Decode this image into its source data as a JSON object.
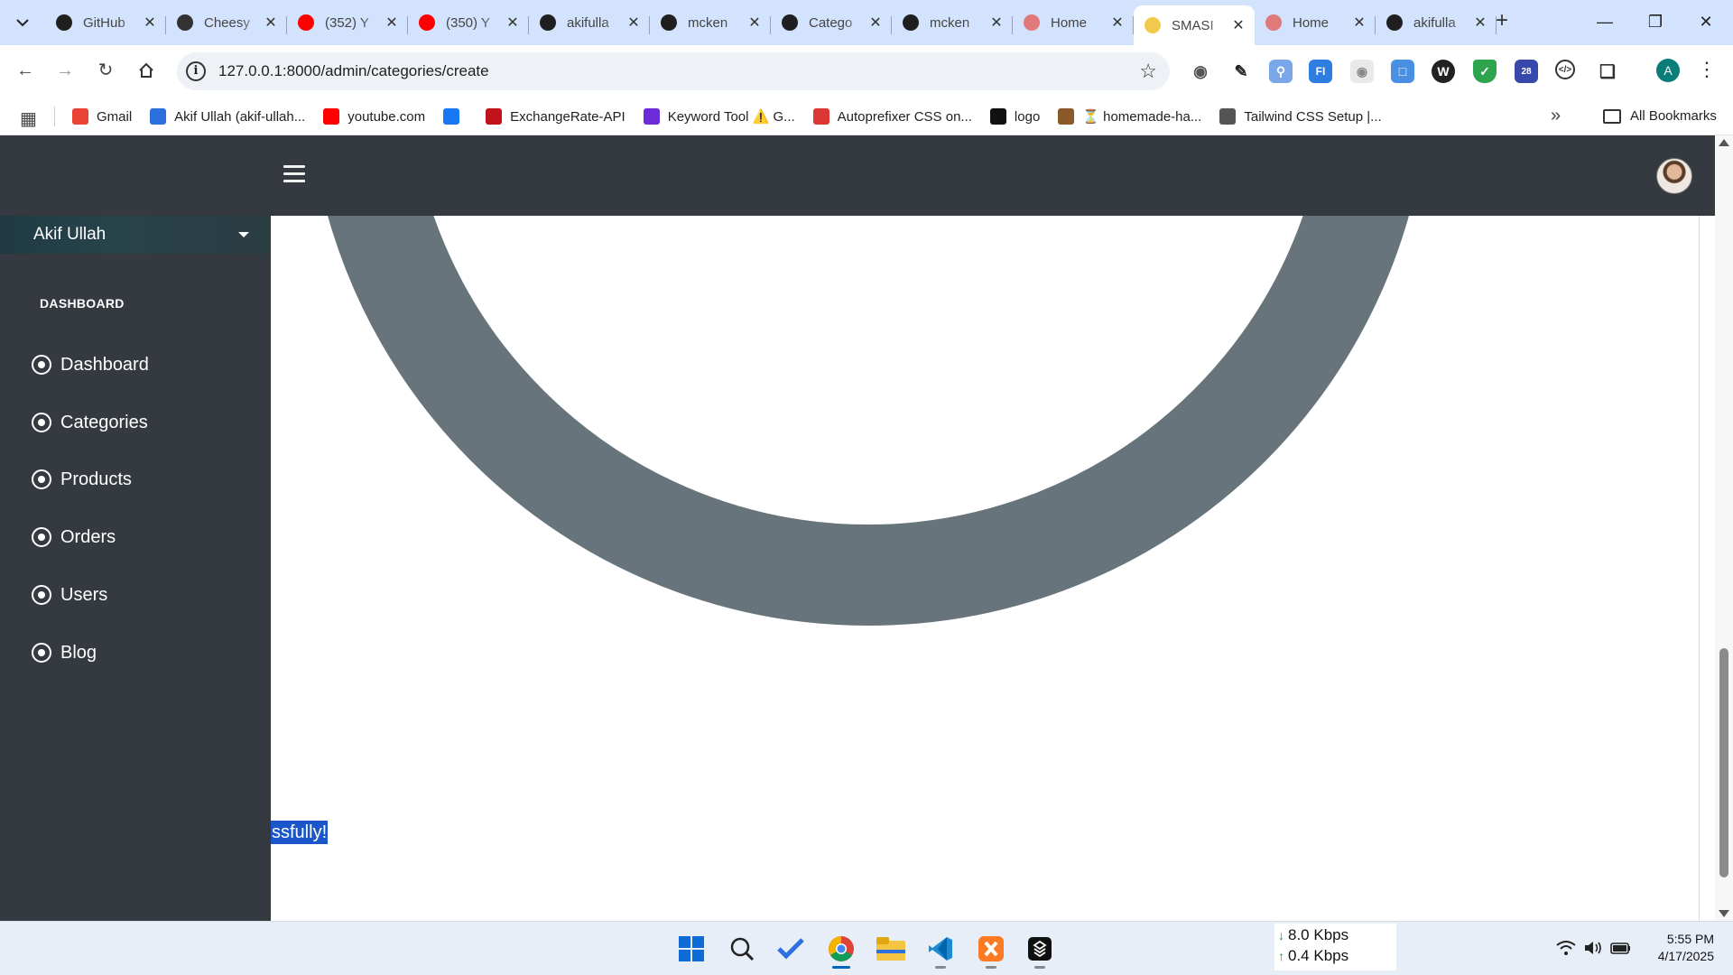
{
  "browser": {
    "tabs": [
      {
        "title": "GitHub",
        "favicon": "github-icon",
        "color": "#1f1f1f"
      },
      {
        "title": "Cheesy",
        "favicon": "cheesy-logo-icon",
        "color": "#333333"
      },
      {
        "title": "(352) Y",
        "favicon": "youtube-icon",
        "color": "#ff0000"
      },
      {
        "title": "(350) Y",
        "favicon": "youtube-icon",
        "color": "#ff0000"
      },
      {
        "title": "akifulla",
        "favicon": "github-icon",
        "color": "#1f1f1f"
      },
      {
        "title": "mcken",
        "favicon": "github-icon",
        "color": "#1f1f1f"
      },
      {
        "title": "Catego",
        "favicon": "openai-icon",
        "color": "#1f1f1f"
      },
      {
        "title": "mcken",
        "favicon": "github-icon",
        "color": "#1f1f1f"
      },
      {
        "title": "Home",
        "favicon": "site-icon",
        "color": "#e07a7a"
      },
      {
        "title": "SMASI",
        "favicon": "site-icon",
        "color": "#f2c94c",
        "active": true
      },
      {
        "title": "Home",
        "favicon": "site-icon",
        "color": "#e07a7a"
      },
      {
        "title": "akifulla",
        "favicon": "github-icon",
        "color": "#1f1f1f"
      }
    ],
    "url": "127.0.0.1:8000/admin/categories/create",
    "profile_initial": "A",
    "extension_badge": "28"
  },
  "bookmarks": {
    "items": [
      {
        "label": "Gmail",
        "icon": "gmail-icon",
        "color": "#ea4335"
      },
      {
        "label": "Akif Ullah (akif-ullah...",
        "icon": "ibb-icon",
        "color": "#2a6fdb"
      },
      {
        "label": "youtube.com",
        "icon": "youtube-icon",
        "color": "#ff0000"
      },
      {
        "label": "",
        "icon": "facebook-icon",
        "color": "#1877f2"
      },
      {
        "label": "ExchangeRate-API",
        "icon": "exchangerate-icon",
        "color": "#c2131c"
      },
      {
        "label": "Keyword Tool ⚠️ G...",
        "icon": "keyword-tool-icon",
        "color": "#6b2bd9"
      },
      {
        "label": "Autoprefixer CSS on...",
        "icon": "autoprefixer-icon",
        "color": "#dd3735"
      },
      {
        "label": "logo",
        "icon": "logo-icon",
        "color": "#111111"
      },
      {
        "label": "⏳ homemade-ha...",
        "icon": "homemade-icon",
        "color": "#8a5a2b"
      },
      {
        "label": "Tailwind CSS Setup |...",
        "icon": "globe-icon",
        "color": "#555555"
      }
    ],
    "all_bookmarks": "All Bookmarks"
  },
  "app": {
    "user_name": "Akif Ullah",
    "nav_header": "DASHBOARD",
    "nav_items": [
      "Dashboard",
      "Categories",
      "Products",
      "Orders",
      "Users",
      "Blog"
    ],
    "selected_text": "ssfully!"
  },
  "taskbar": {
    "net_down": "8.0 Kbps",
    "net_up": "0.4 Kbps",
    "time": "5:55 PM",
    "date": "4/17/2025"
  },
  "colors": {
    "navbar": "#343a40",
    "sidebar": "#343a40",
    "ring": "#68747b",
    "selection": "#1a56c9",
    "tab_strip": "#d3e3fd"
  }
}
